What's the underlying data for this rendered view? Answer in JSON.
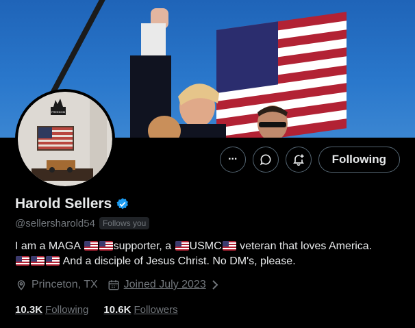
{
  "profile": {
    "name": "Harold Sellers",
    "handle": "@sellersharold54",
    "follows_you": "Follows you",
    "bio_line1_a": "I am a MAGA",
    "bio_line1_b": "supporter, a",
    "bio_line1_c": "USMC",
    "bio_line1_d": "veteran that loves America.",
    "bio_line2": "And a  disciple of Jesus Christ. No DM's, please.",
    "location": "Princeton, TX",
    "joined": "Joined July 2023",
    "following_count": "10.3K",
    "following_label": "Following",
    "followers_count": "10.6K",
    "followers_label": "Followers"
  },
  "actions": {
    "more": "···",
    "follow_button": "Following"
  },
  "avatar_sign": "FREEDOM",
  "colors": {
    "background": "#000000",
    "primary_text": "#e7e9ea",
    "secondary_text": "#71767b",
    "border": "#536471",
    "verified": "#1d9bf0",
    "banner_sky": "#2a78cc"
  },
  "icons": [
    "more-icon",
    "message-icon",
    "notify-icon",
    "verified-badge-icon",
    "location-icon",
    "calendar-icon",
    "chevron-right-icon"
  ]
}
